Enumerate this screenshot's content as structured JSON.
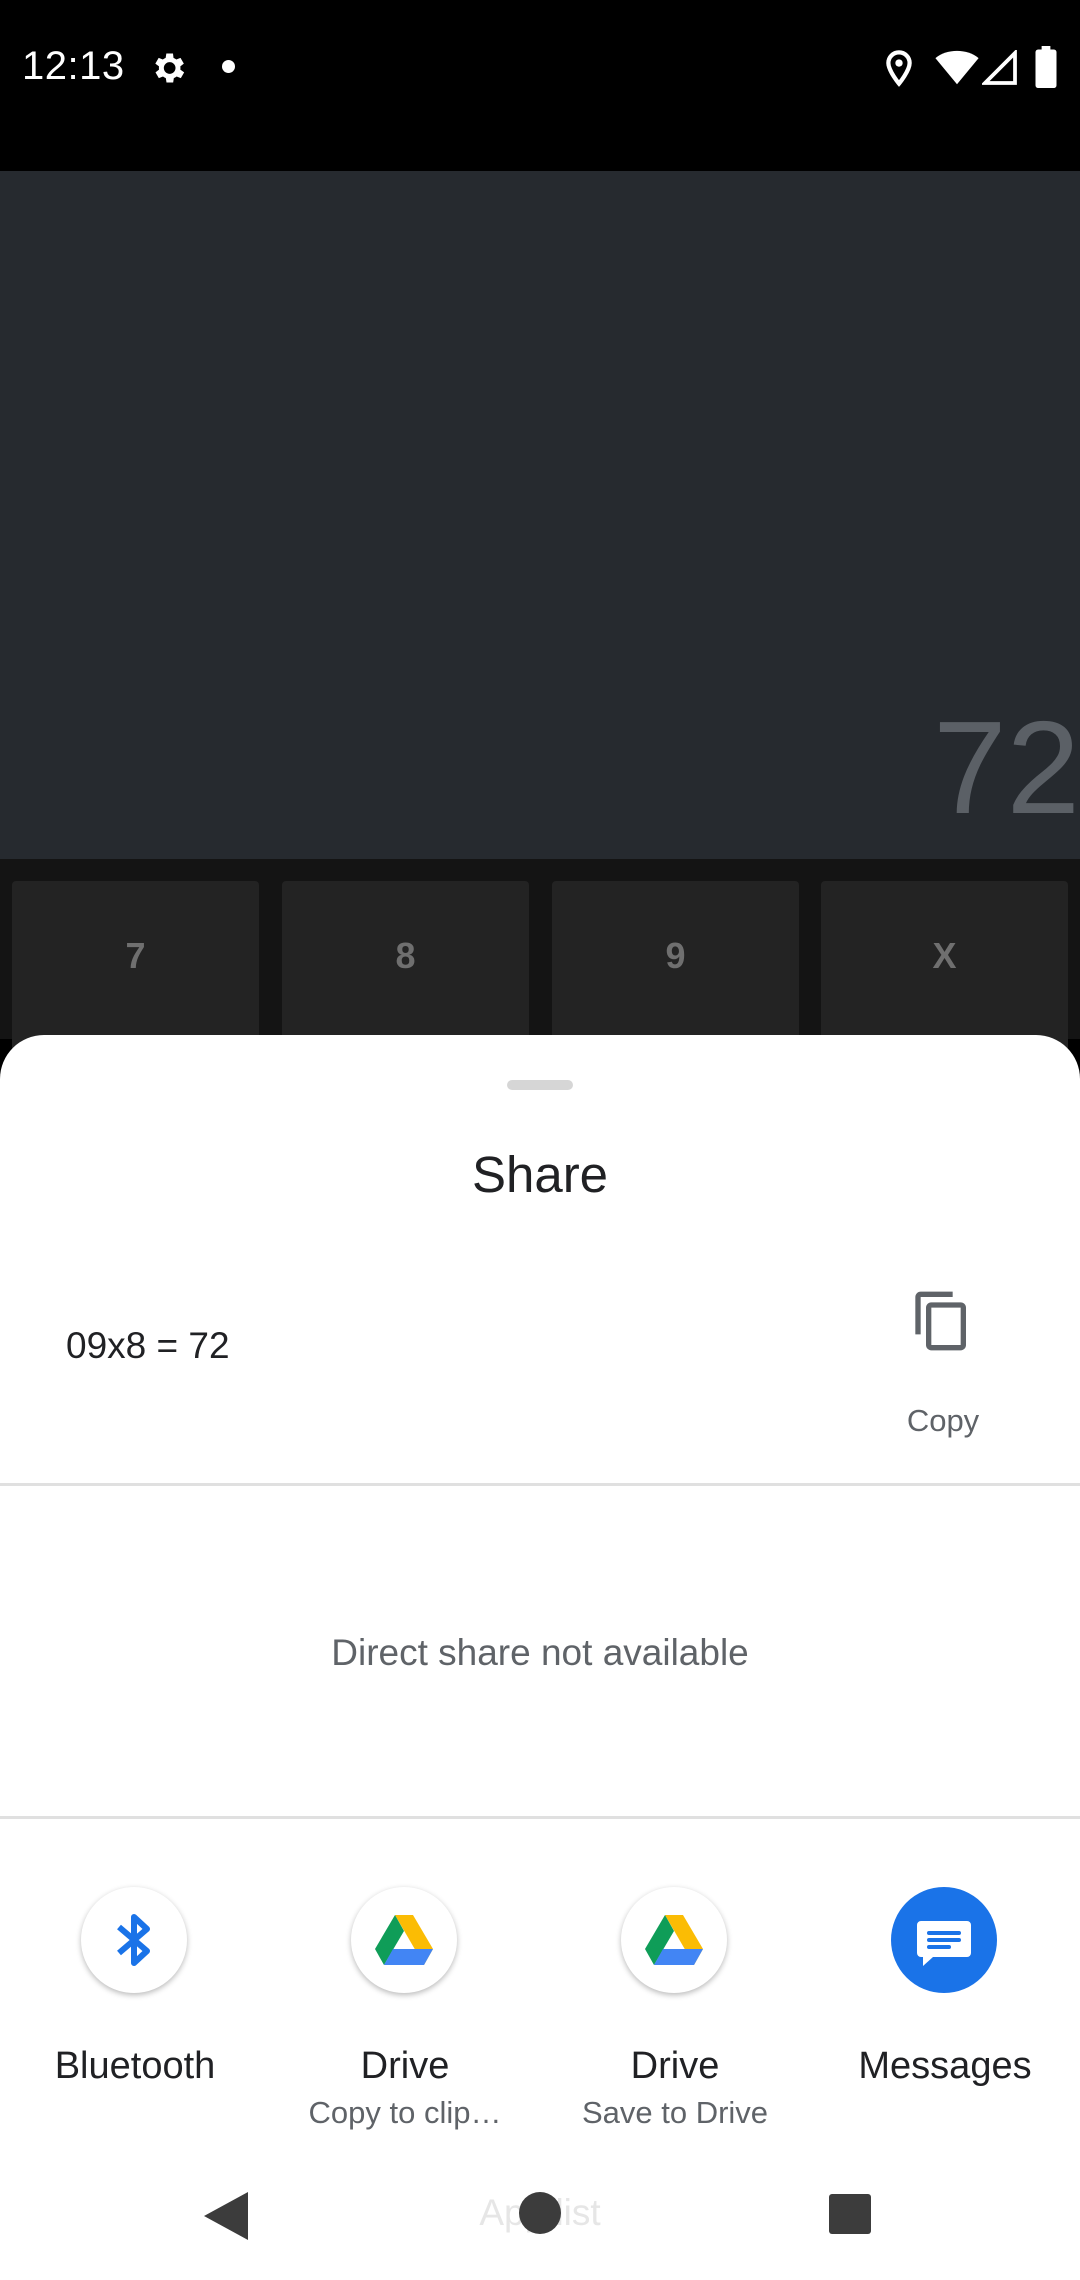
{
  "status_bar": {
    "time": "12:13"
  },
  "calculator": {
    "result": "72",
    "keys": [
      "7",
      "8",
      "9",
      "X"
    ]
  },
  "share_sheet": {
    "title": "Share",
    "content_text": "09x8 = 72",
    "copy_label": "Copy",
    "direct_share_message": "Direct share not available",
    "targets": [
      {
        "label": "Bluetooth",
        "sublabel": "",
        "icon": "bluetooth-icon"
      },
      {
        "label": "Drive",
        "sublabel": "Copy to clip…",
        "icon": "google-drive-icon"
      },
      {
        "label": "Drive",
        "sublabel": "Save to Drive",
        "icon": "google-drive-icon"
      },
      {
        "label": "Messages",
        "sublabel": "",
        "icon": "messages-icon"
      }
    ]
  },
  "nav_bar": {
    "hidden_label": "App list"
  },
  "colors": {
    "accent_blue": "#1a73e8",
    "sheet_bg": "#ffffff",
    "calc_bg": "#262a2f"
  }
}
